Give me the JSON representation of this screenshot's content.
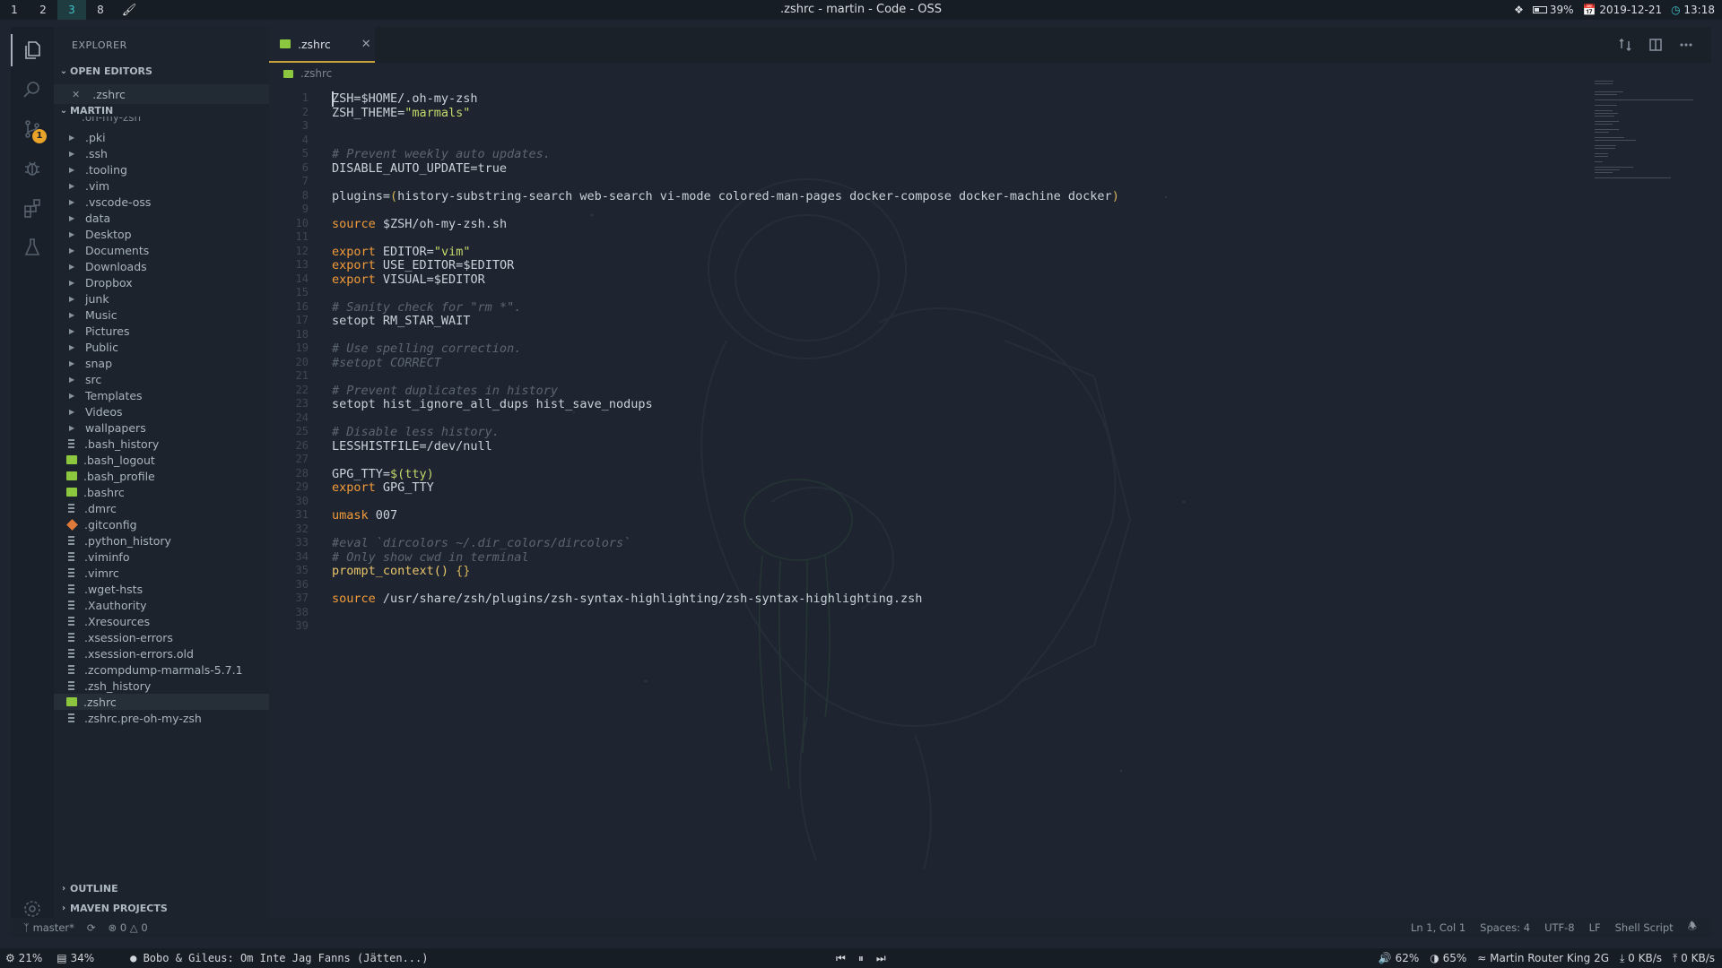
{
  "topbar": {
    "workspaces": [
      {
        "label": "1",
        "active": false
      },
      {
        "label": "2",
        "active": false
      },
      {
        "label": "3",
        "active": true
      },
      {
        "label": "8",
        "active": false
      }
    ],
    "brush_icon": "paintbrush-icon",
    "window_title": ".zshrc - martin - Code - OSS",
    "tray": {
      "battery_percent": "39%",
      "date": "2019-12-21",
      "time": "13:18"
    }
  },
  "activity_bar": {
    "items": [
      {
        "icon": "files-icon",
        "active": true
      },
      {
        "icon": "search-icon",
        "active": false
      },
      {
        "icon": "source-control-icon",
        "active": false,
        "badge": "1"
      },
      {
        "icon": "debug-icon",
        "active": false
      },
      {
        "icon": "extensions-icon",
        "active": false
      },
      {
        "icon": "flask-icon",
        "active": false
      }
    ],
    "bottom_icon": "settings-gear-icon"
  },
  "sidebar": {
    "title": "EXPLORER",
    "open_editors_label": "OPEN EDITORS",
    "open_editor_file": ".zshrc",
    "folder_label": "MARTIN",
    "scrolled_partial": ".oh-my-zsh",
    "items": [
      {
        "name": ".pki",
        "type": "folder"
      },
      {
        "name": ".ssh",
        "type": "folder"
      },
      {
        "name": ".tooling",
        "type": "folder"
      },
      {
        "name": ".vim",
        "type": "folder"
      },
      {
        "name": ".vscode-oss",
        "type": "folder"
      },
      {
        "name": "data",
        "type": "folder"
      },
      {
        "name": "Desktop",
        "type": "folder"
      },
      {
        "name": "Documents",
        "type": "folder"
      },
      {
        "name": "Downloads",
        "type": "folder"
      },
      {
        "name": "Dropbox",
        "type": "folder"
      },
      {
        "name": "junk",
        "type": "folder"
      },
      {
        "name": "Music",
        "type": "folder"
      },
      {
        "name": "Pictures",
        "type": "folder"
      },
      {
        "name": "Public",
        "type": "folder"
      },
      {
        "name": "snap",
        "type": "folder"
      },
      {
        "name": "src",
        "type": "folder"
      },
      {
        "name": "Templates",
        "type": "folder"
      },
      {
        "name": "Videos",
        "type": "folder"
      },
      {
        "name": "wallpapers",
        "type": "folder"
      },
      {
        "name": ".bash_history",
        "type": "txt"
      },
      {
        "name": ".bash_logout",
        "type": "sh"
      },
      {
        "name": ".bash_profile",
        "type": "sh"
      },
      {
        "name": ".bashrc",
        "type": "sh"
      },
      {
        "name": ".dmrc",
        "type": "txt"
      },
      {
        "name": ".gitconfig",
        "type": "git"
      },
      {
        "name": ".python_history",
        "type": "txt"
      },
      {
        "name": ".viminfo",
        "type": "txt"
      },
      {
        "name": ".vimrc",
        "type": "txt"
      },
      {
        "name": ".wget-hsts",
        "type": "txt"
      },
      {
        "name": ".Xauthority",
        "type": "txt"
      },
      {
        "name": ".Xresources",
        "type": "txt"
      },
      {
        "name": ".xsession-errors",
        "type": "txt"
      },
      {
        "name": ".xsession-errors.old",
        "type": "txt"
      },
      {
        "name": ".zcompdump-marmals-5.7.1",
        "type": "txt"
      },
      {
        "name": ".zsh_history",
        "type": "txt"
      },
      {
        "name": ".zshrc",
        "type": "sh",
        "selected": true
      },
      {
        "name": ".zshrc.pre-oh-my-zsh",
        "type": "txt"
      }
    ],
    "outline_label": "OUTLINE",
    "maven_label": "MAVEN PROJECTS"
  },
  "editor": {
    "tab_label": ".zshrc",
    "breadcrumb": ".zshrc",
    "lines": [
      [
        [
          "",
          "ZSH=$HOME/.oh-my-zsh"
        ]
      ],
      [
        [
          "",
          "ZSH_THEME="
        ],
        [
          "str",
          "\"marmals\""
        ]
      ],
      [],
      [],
      [
        [
          "cm",
          "# Prevent weekly auto updates."
        ]
      ],
      [
        [
          "",
          "DISABLE_AUTO_UPDATE=true"
        ]
      ],
      [],
      [
        [
          "",
          "plugins="
        ],
        [
          "par",
          "("
        ],
        [
          "",
          "history-substring-search web-search vi-mode colored-man-pages docker-compose docker-machine docker"
        ],
        [
          "par",
          ")"
        ]
      ],
      [],
      [
        [
          "kw",
          "source"
        ],
        [
          "",
          " $ZSH/oh-my-zsh.sh"
        ]
      ],
      [],
      [
        [
          "kw",
          "export"
        ],
        [
          "",
          " EDITOR="
        ],
        [
          "str",
          "\"vim\""
        ]
      ],
      [
        [
          "kw",
          "export"
        ],
        [
          "",
          " USE_EDITOR=$EDITOR"
        ]
      ],
      [
        [
          "kw",
          "export"
        ],
        [
          "",
          " VISUAL=$EDITOR"
        ]
      ],
      [],
      [
        [
          "cm",
          "# Sanity check for \"rm *\"."
        ]
      ],
      [
        [
          "",
          "setopt RM_STAR_WAIT"
        ]
      ],
      [],
      [
        [
          "cm",
          "# Use spelling correction."
        ]
      ],
      [
        [
          "cm",
          "#setopt CORRECT"
        ]
      ],
      [],
      [
        [
          "cm",
          "# Prevent duplicates in history"
        ]
      ],
      [
        [
          "",
          "setopt hist_ignore_all_dups hist_save_nodups"
        ]
      ],
      [],
      [
        [
          "cm",
          "# Disable less history."
        ]
      ],
      [
        [
          "",
          "LESSHISTFILE=/dev/null"
        ]
      ],
      [],
      [
        [
          "",
          "GPG_TTY="
        ],
        [
          "str",
          "$(tty)"
        ]
      ],
      [
        [
          "kw",
          "export"
        ],
        [
          "",
          " GPG_TTY"
        ]
      ],
      [],
      [
        [
          "kw",
          "umask"
        ],
        [
          "",
          " 007"
        ]
      ],
      [],
      [
        [
          "cm",
          "#eval `dircolors ~/.dir_colors/dircolors`"
        ]
      ],
      [
        [
          "cm",
          "# Only show cwd in terminal"
        ]
      ],
      [
        [
          "fn",
          "prompt_context() "
        ],
        [
          "par",
          "{}"
        ]
      ],
      [],
      [
        [
          "kw",
          "source"
        ],
        [
          "",
          " /usr/share/zsh/plugins/zsh-syntax-highlighting/zsh-syntax-highlighting.zsh"
        ]
      ],
      [],
      []
    ]
  },
  "statusbar": {
    "branch": "master*",
    "errors": "0",
    "warnings": "0",
    "position": "Ln 1, Col 1",
    "spaces": "Spaces: 4",
    "encoding": "UTF-8",
    "eol": "LF",
    "language": "Shell Script"
  },
  "bottombar": {
    "cpu": "21%",
    "mem": "34%",
    "now_playing": "Bobo & Gileus: Om Inte Jag Fanns (Jätten...)",
    "volume": "62%",
    "brightness": "65%",
    "wifi": "Martin Router King 2G",
    "download": "0 KB/s",
    "upload": "0 KB/s"
  },
  "colors": {
    "accent_teal": "#3fc1c9",
    "keyword": "#f29b3a",
    "string": "#c3d86b",
    "comment": "#5c6672",
    "tab_underline": "#c8a13a",
    "badge": "#e9a32a"
  }
}
